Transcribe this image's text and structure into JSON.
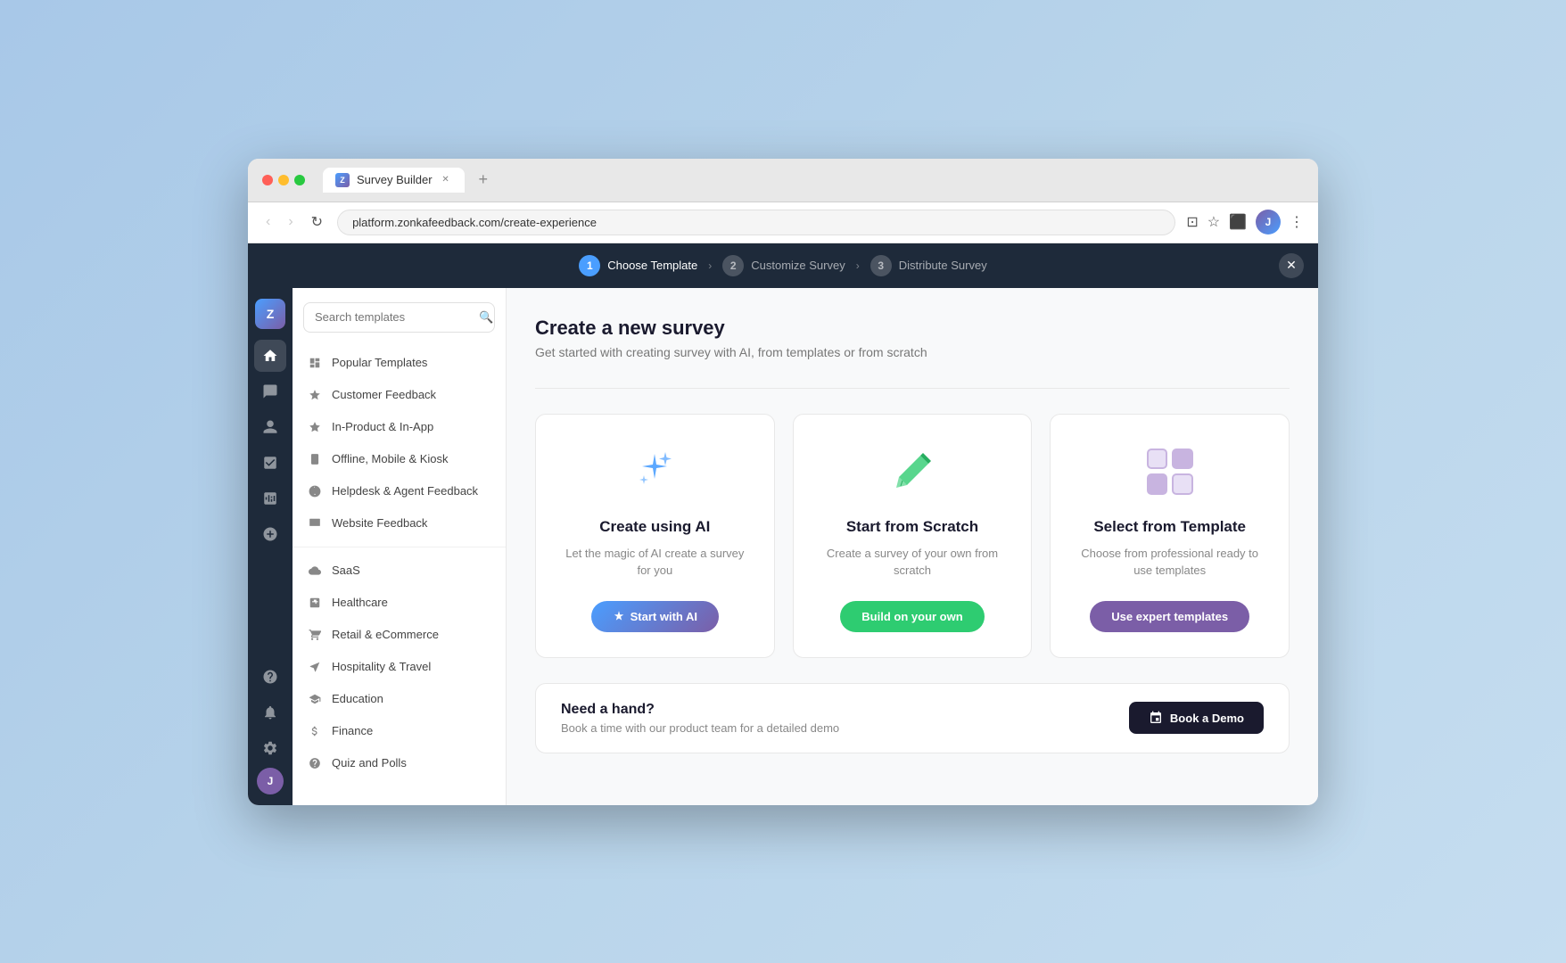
{
  "browser": {
    "tab_title": "Survey Builder",
    "url": "platform.zonkafeedback.com/create-experience",
    "new_tab_btn": "+"
  },
  "stepper": {
    "steps": [
      {
        "number": "1",
        "label": "Choose Template",
        "active": true
      },
      {
        "number": "2",
        "label": "Customize Survey",
        "active": false
      },
      {
        "number": "3",
        "label": "Distribute Survey",
        "active": false
      }
    ],
    "close_label": "✕"
  },
  "sidebar": {
    "logo_text": "Z",
    "icons": [
      {
        "name": "home",
        "symbol": "⊞",
        "active": true
      },
      {
        "name": "feedback",
        "symbol": "💬",
        "active": false
      },
      {
        "name": "users",
        "symbol": "👤",
        "active": false
      },
      {
        "name": "tasks",
        "symbol": "☑",
        "active": false
      },
      {
        "name": "analytics",
        "symbol": "⬡",
        "active": false
      },
      {
        "name": "add",
        "symbol": "+",
        "active": false
      }
    ],
    "user_initial": "J"
  },
  "left_nav": {
    "search_placeholder": "Search templates",
    "sections": [
      {
        "items": [
          {
            "label": "Popular Templates",
            "icon": "⊞"
          },
          {
            "label": "Customer Feedback",
            "icon": "★"
          },
          {
            "label": "In-Product & In-App",
            "icon": "◈"
          },
          {
            "label": "Offline, Mobile & Kiosk",
            "icon": "📱"
          },
          {
            "label": "Helpdesk & Agent Feedback",
            "icon": "🎧"
          },
          {
            "label": "Website Feedback",
            "icon": "⬛"
          }
        ]
      },
      {
        "items": [
          {
            "label": "SaaS",
            "icon": "○"
          },
          {
            "label": "Healthcare",
            "icon": "✦"
          },
          {
            "label": "Retail & eCommerce",
            "icon": "🛒"
          },
          {
            "label": "Hospitality & Travel",
            "icon": "○"
          },
          {
            "label": "Education",
            "icon": "🎓"
          },
          {
            "label": "Finance",
            "icon": "○"
          },
          {
            "label": "Quiz and Polls",
            "icon": "○"
          }
        ]
      }
    ]
  },
  "content": {
    "page_title": "Create a new survey",
    "page_subtitle": "Get started with creating survey with AI, from templates or from scratch",
    "cards": [
      {
        "id": "ai",
        "title": "Create using AI",
        "description": "Let the magic of AI create a survey for you",
        "btn_label": "Start with AI",
        "btn_type": "ai"
      },
      {
        "id": "scratch",
        "title": "Start from Scratch",
        "description": "Create a survey of your own from scratch",
        "btn_label": "Build on your own",
        "btn_type": "green"
      },
      {
        "id": "template",
        "title": "Select from Template",
        "description": "Choose from professional ready to use templates",
        "btn_label": "Use expert templates",
        "btn_type": "purple"
      }
    ],
    "help_card": {
      "title": "Need a hand?",
      "subtitle": "Book a time with our product team for a detailed demo",
      "btn_label": "Book a Demo"
    }
  }
}
